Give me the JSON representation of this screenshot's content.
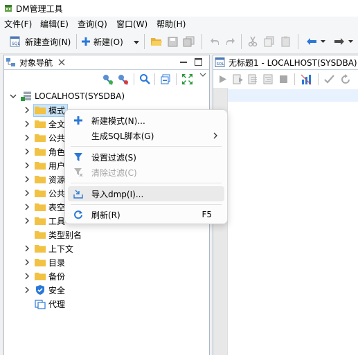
{
  "window": {
    "title": "DM管理工具"
  },
  "menu": [
    "文件(F)",
    "编辑(E)",
    "查询(Q)",
    "窗口(W)",
    "帮助(H)"
  ],
  "toolbar": {
    "new_query": "新建查询(N)",
    "new": "新建(O)"
  },
  "left_panel": {
    "tab_title": "对象导航",
    "root": "LOCALHOST(SYSDBA)",
    "items": [
      "模式",
      "全文",
      "公共",
      "角色",
      "用户",
      "资源",
      "公共",
      "表空",
      "工具",
      "类型别名",
      "上下文",
      "目录",
      "备份",
      "安全",
      "代理"
    ]
  },
  "editor": {
    "tab_title": "无标题1 - LOCALHOST(SYSDBA)"
  },
  "context_menu": {
    "items": [
      {
        "label": "新建模式(N)...",
        "shortcut": "",
        "enabled": true
      },
      {
        "label": "生成SQL脚本(G)",
        "shortcut": "",
        "enabled": true
      },
      {
        "label": "设置过滤(S)",
        "shortcut": "",
        "enabled": true
      },
      {
        "label": "清除过滤(C)",
        "shortcut": "",
        "enabled": false
      },
      {
        "label": "导入dmp(I)...",
        "shortcut": "",
        "enabled": true
      },
      {
        "label": "刷新(R)",
        "shortcut": "F5",
        "enabled": true
      }
    ]
  },
  "colors": {
    "accent": "#2b78d8",
    "folder": "#f2c244",
    "selection": "#cce4f7",
    "green": "#2a9a3c"
  }
}
